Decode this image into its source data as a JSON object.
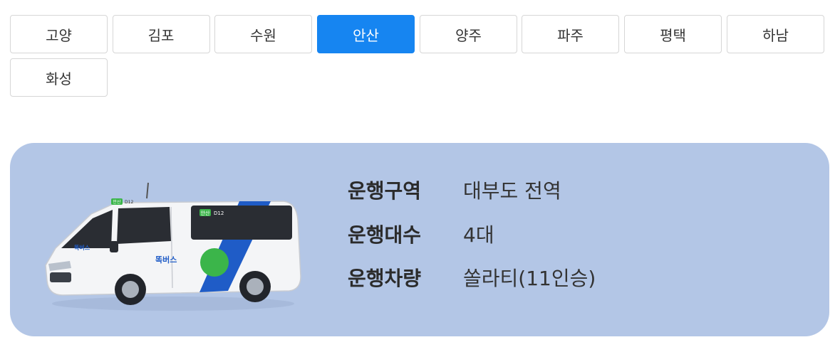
{
  "regions": {
    "tabs": [
      "고양",
      "김포",
      "수원",
      "안산",
      "양주",
      "파주",
      "평택",
      "하남",
      "화성"
    ],
    "selected": "안산"
  },
  "info": {
    "area_label": "운행구역",
    "area_value": "대부도 전역",
    "count_label": "운행대수",
    "count_value": "4대",
    "vehicle_label": "운행차량",
    "vehicle_value": "쏠라티(11인승)"
  },
  "van": {
    "brand_text": "똑버스",
    "region_badge": "안산",
    "route_code": "D12",
    "colors": {
      "body": "#f4f5f7",
      "stripe_blue": "#1f5cc7",
      "circle_green": "#3bb54a",
      "window": "#2a2d33"
    }
  },
  "colors": {
    "active_tab": "#1685f1",
    "card_background": "#b3c6e6"
  }
}
